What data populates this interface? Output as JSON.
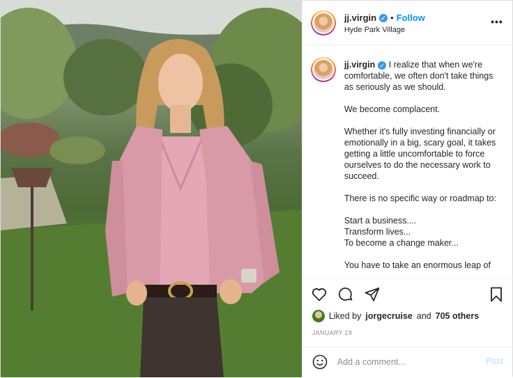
{
  "header": {
    "username": "jj.virgin",
    "separator": "•",
    "follow_label": "Follow",
    "location": "Hyde Park Village",
    "more_label": "•••"
  },
  "caption": {
    "username": "jj.virgin",
    "text": " I realize that when we're comfortable, we often don't take things as seriously as we should.\n\nWe become complacent.\n\nWhether it's fully investing financially or emotionally in a big, scary goal, it takes getting a little uncomfortable to force ourselves to do the necessary work to succeed.\n\nThere is no specific way or roadmap to:\n\nStart a business....\nTransform lives...\nTo become a change maker...\n\nYou have to take an enormous leap of"
  },
  "actions": {
    "icons": [
      "heart-icon",
      "comment-icon",
      "share-icon",
      "bookmark-icon"
    ]
  },
  "likes": {
    "prefix": "Liked by",
    "user": "jorgecruise",
    "connector": "and",
    "others": "705 others"
  },
  "date": "JANUARY 19",
  "comment": {
    "placeholder": "Add a comment...",
    "post_label": "Post"
  },
  "colors": {
    "accent": "#0095f6",
    "verified": "#3897f0",
    "post_disabled": "#b2dffc",
    "jacket": "#d89aa6"
  }
}
